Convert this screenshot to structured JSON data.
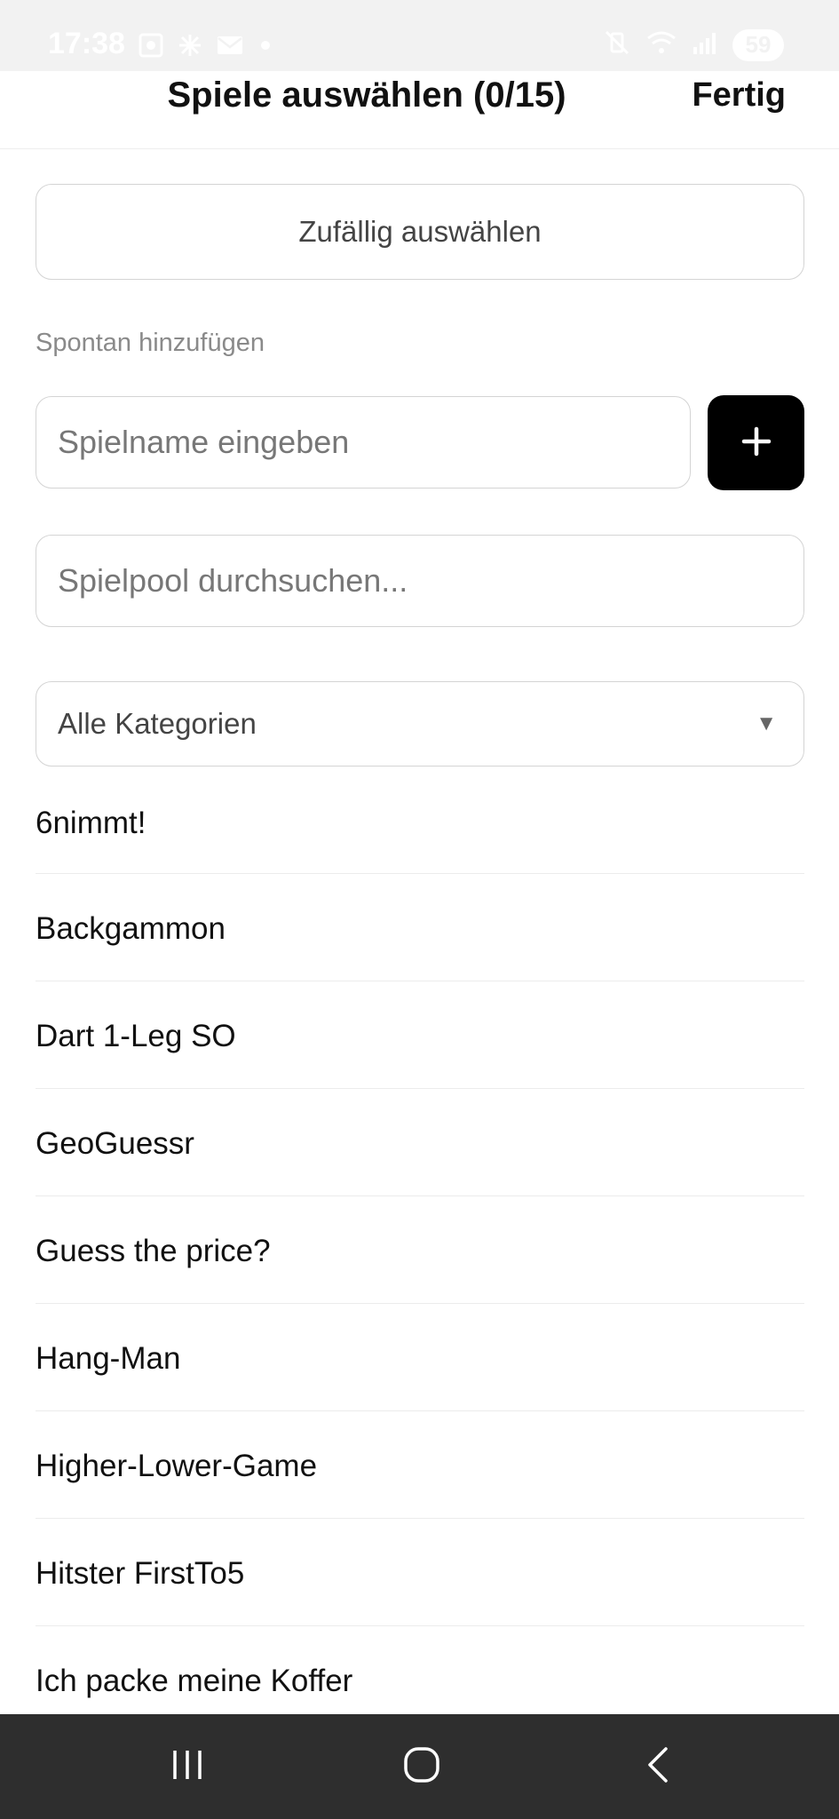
{
  "status_bar": {
    "time": "17:38",
    "battery": "59",
    "left_icons": [
      "screenshot-icon",
      "fan-icon",
      "mail-icon",
      "dot-icon"
    ],
    "right_icons": [
      "mute-vibrate-icon",
      "wifi-icon",
      "signal-icon"
    ]
  },
  "header": {
    "title": "Spiele auswählen (0/15)",
    "done_label": "Fertig"
  },
  "random_button": {
    "label": "Zufällig auswählen"
  },
  "spontaneous": {
    "label": "Spontan hinzufügen",
    "input_placeholder": "Spielname eingeben",
    "input_value": "",
    "add_icon": "plus-icon"
  },
  "search": {
    "placeholder": "Spielpool durchsuchen...",
    "value": ""
  },
  "category": {
    "selected": "Alle Kategorien",
    "chevron": "▼"
  },
  "games": [
    "6nimmt!",
    "Backgammon",
    "Dart 1-Leg SO",
    "GeoGuessr",
    "Guess the price?",
    "Hang-Man",
    "Higher-Lower-Game",
    "Hitster FirstTo5",
    "Ich packe meine Koffer"
  ],
  "nav_bar": {
    "icons": [
      "recent-apps-icon",
      "home-icon",
      "back-icon"
    ]
  },
  "colors": {
    "status_bar_bg": "#f2f2f2",
    "nav_bar_bg": "#2e2e2e",
    "accent_button": "#000000",
    "border": "#d4d4d4",
    "secondary_text": "#8a8a8a"
  }
}
